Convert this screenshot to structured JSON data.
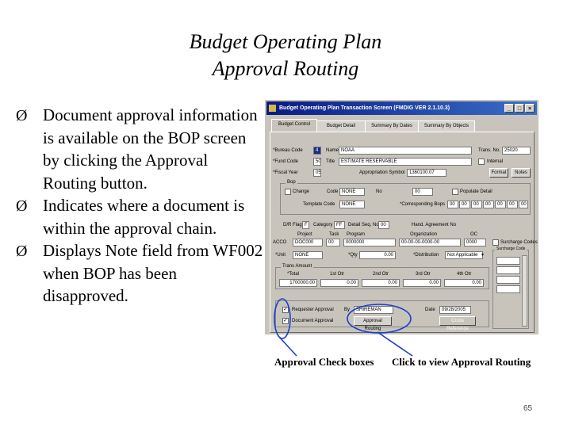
{
  "slide": {
    "title_line1": "Budget Operating Plan",
    "title_line2": "Approval Routing",
    "bullets": [
      "Document approval information is available on the BOP screen by clicking the Approval Routing button.",
      "Indicates where a document is within the approval chain.",
      "Displays Note field from WF002 when BOP has been disapproved."
    ],
    "bullet_glyph": "Ø",
    "captions": {
      "left": "Approval Check boxes",
      "right": "Click to view Approval Routing"
    },
    "page_number": "65",
    "annotation_color": "#1a3fc9"
  },
  "window": {
    "title": "Budget Operating Plan Transaction Screen (FMDIG VER 2.1.10.3)",
    "controls": [
      "_",
      "□",
      "×"
    ],
    "tabs": [
      "Budget Control",
      "Budget Detail",
      "Summary By Dates",
      "Summary By Objects"
    ],
    "fields": {
      "bureau_code_label": "*Bureau Code",
      "bureau_code_value": "4",
      "name_label": "Name",
      "name_value": "NOAA",
      "fund_code_label": "*Fund Code",
      "fund_code_value": "50",
      "title_label": "Title",
      "title_value": "ESTIMATE RESERVABLE",
      "fiscal_year_label": "*Fiscal Year",
      "fiscal_year_value": "05",
      "approp_label": "Appropriation Symbol",
      "approp_value": "1360100.07",
      "trans_no_label": "Trans. No.",
      "trans_no_value": "25020",
      "internal_label": "Internal",
      "format_button": "Format",
      "notes_button": "Notes",
      "bop_group": "Bop",
      "change_label": "Change",
      "code_label": "Code",
      "code_value": "NONE",
      "no_label": "No",
      "no_value": "00",
      "populate_label": "Populate Detail",
      "template_label": "Template Code",
      "template_value": "NONE",
      "corr_bops_label": "*Corresponding Bops",
      "corr_bops_values": [
        "00",
        "00",
        "00",
        "00",
        "00",
        "00",
        "00"
      ],
      "dr_flag_label": "D/R Flag",
      "dr_flag_value": "F",
      "category_label": "Category",
      "category_value": "FF",
      "detail_label": "Detail Seq. No",
      "detail_value": "00",
      "hand_label": "Hand. Agreement No",
      "col_headers": [
        "Project",
        "Task",
        "Program",
        "Organization",
        "OC"
      ],
      "acco_label": "ACCO",
      "acco_values": [
        "DOC000",
        "00",
        "0000000",
        "00-00-00-0000-00",
        "0000"
      ],
      "unit_label": "*Unit",
      "unit_value": "NONE",
      "qty_label": "*Qty",
      "qty_value": "0.00",
      "distribution_label": "*Distribution",
      "distribution_value": "Not Applicable",
      "surcharge_label": "Surcharge Codes",
      "surcharge_group": "Surcharge Code",
      "trans_amount_group": "Trans Amount",
      "amount_headers": [
        "*Total",
        "1st Otr",
        "2nd Otr",
        "3rd Otr",
        "4th Otr"
      ],
      "amount_values": [
        "1700000.00",
        "0.00",
        "0.00",
        "0.00",
        "0.00"
      ],
      "requester_label": "Requester Approval",
      "document_label": "Document Approval",
      "by_label": "By",
      "by_value": "SHIREMAN",
      "date_label": "Date",
      "date_value": "09/28/2005",
      "approval_routing_button": "Approval Routing",
      "cross_button": "Cross Reference"
    }
  }
}
